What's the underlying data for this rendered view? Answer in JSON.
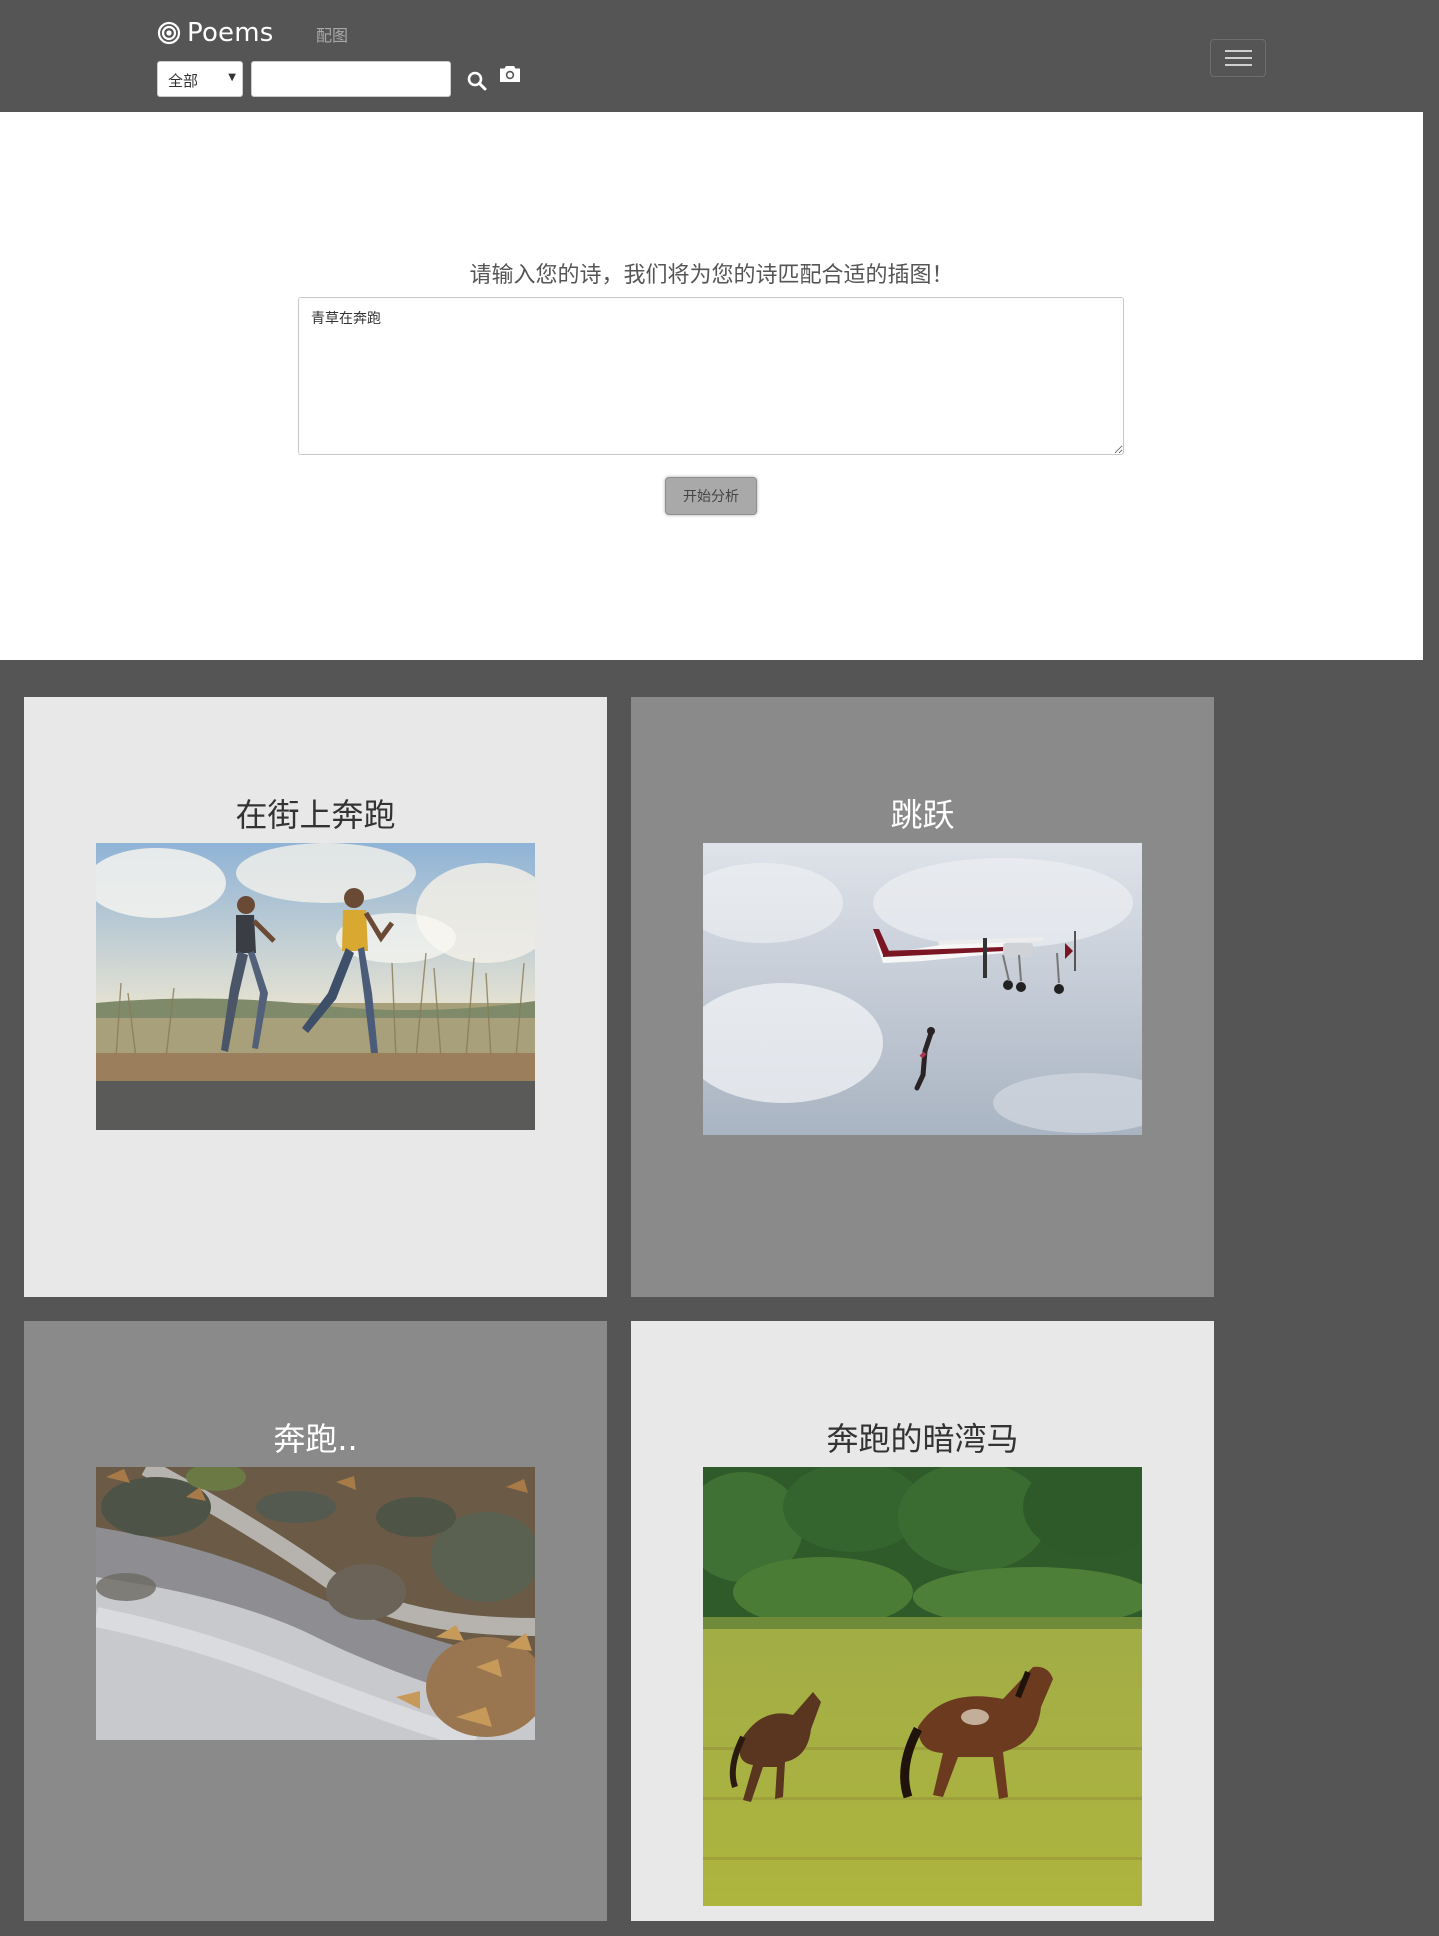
{
  "navbar": {
    "brand": "Poems",
    "nav_link": "配图",
    "category_select": "全部",
    "search_placeholder": ""
  },
  "hero": {
    "title": "请输入您的诗，我们将为您的诗匹配合适的插图！",
    "poem_text": "青草在奔跑",
    "analyze_button": "开始分析"
  },
  "results": [
    {
      "title": "在街上奔跑"
    },
    {
      "title": "跳跃"
    },
    {
      "title": "奔跑.."
    },
    {
      "title": "奔跑的暗湾马"
    }
  ]
}
